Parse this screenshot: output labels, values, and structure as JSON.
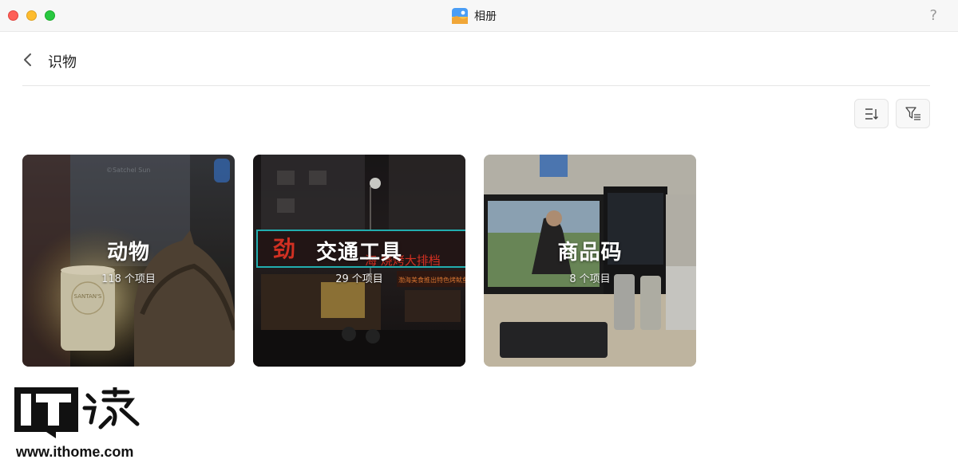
{
  "window": {
    "title": "相册"
  },
  "header": {
    "title": "识物"
  },
  "toolbar": {
    "sort_icon": "sort-icon",
    "filter_icon": "filter-icon"
  },
  "cards": [
    {
      "label": "动物",
      "count": "118",
      "unit": "个项目"
    },
    {
      "label": "交通工具",
      "count": "29",
      "unit": "个项目"
    },
    {
      "label": "商品码",
      "count": "8",
      "unit": "个项目"
    }
  ],
  "card_photo_text": {
    "card0_photo_credit": "©Satchel Sun",
    "card0_cup_text": "SANTAN'S",
    "card1_sign": "劲",
    "card1_sign2": "海 烧烤大排档",
    "card1_shop": "渤海美食推出特色烤鱿鱼"
  },
  "watermark": {
    "logo": "IT之家",
    "url": "www.ithome.com"
  }
}
